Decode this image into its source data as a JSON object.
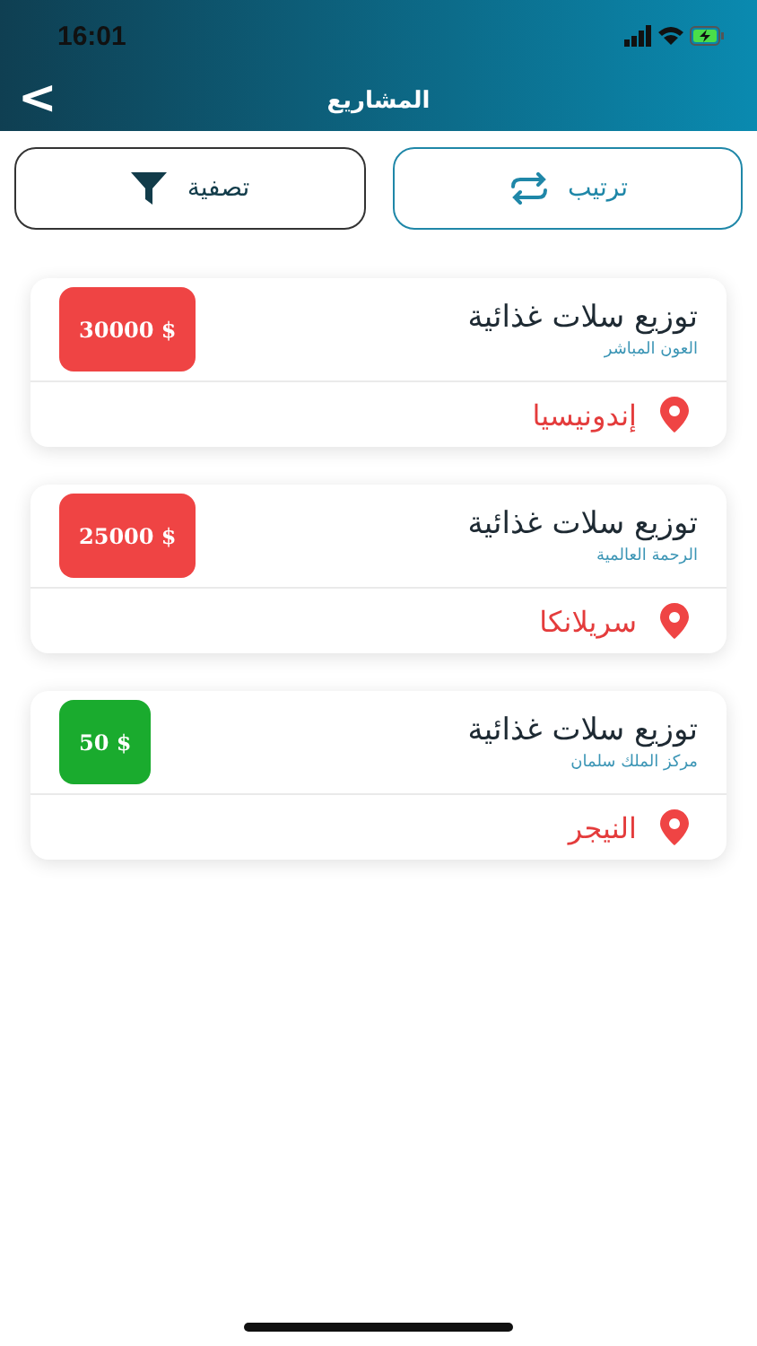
{
  "status_bar": {
    "time": "16:01"
  },
  "nav": {
    "title": "المشاريع",
    "back": "<"
  },
  "actions": [
    {
      "kind": "sort",
      "label": "ترتيب"
    },
    {
      "kind": "filter",
      "label": "تصفية"
    }
  ],
  "projects": [
    {
      "title": "توزيع سلات غذائية",
      "org": "العون المباشر",
      "amount": "30000 $",
      "color": "#ef4444",
      "country": "إندونيسيا"
    },
    {
      "title": "توزيع سلات غذائية",
      "org": "الرحمة العالمية",
      "amount": "25000 $",
      "color": "#ef4444",
      "country": "سريلانكا"
    },
    {
      "title": "توزيع سلات غذائية",
      "org": "مركز الملك سلمان",
      "amount": "50 $",
      "color": "#1aab2e",
      "country": "النيجر"
    }
  ]
}
